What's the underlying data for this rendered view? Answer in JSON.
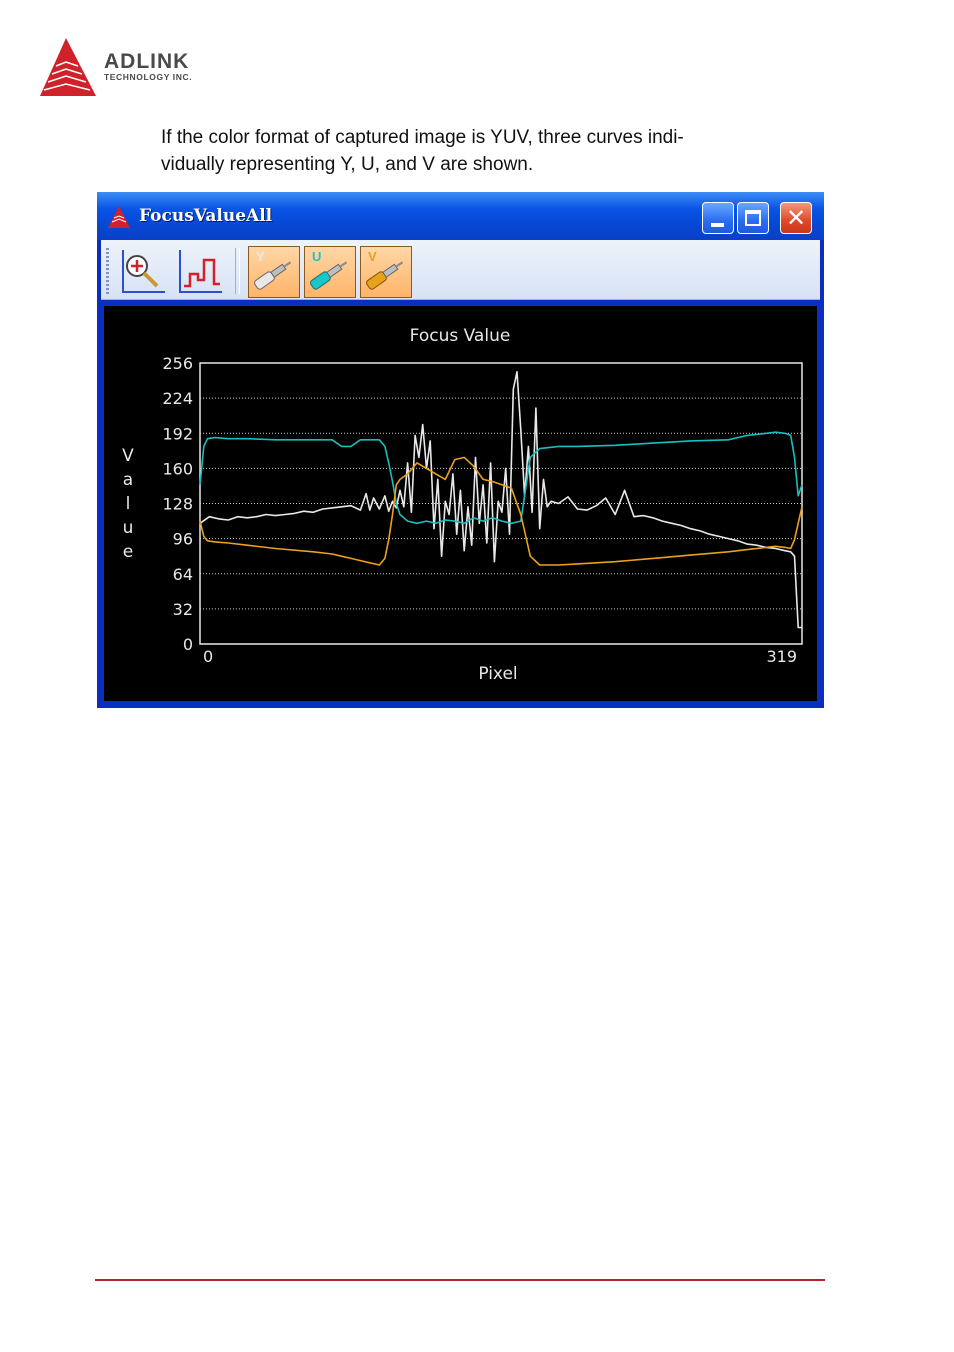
{
  "logo": {
    "name": "ADLINK",
    "subtitle": "TECHNOLOGY INC.",
    "brand_color": "#d0222a"
  },
  "intro": {
    "line1": "If the color format of captured image is YUV, three curves indi-",
    "line2": "vidually representing Y, U, and V are shown."
  },
  "window": {
    "title": "FocusValueAll",
    "controls": {
      "minimize": "minimize",
      "maximize": "maximize",
      "close": "close"
    }
  },
  "toolbar": {
    "buttons": [
      {
        "icon": "zoom-chart-icon",
        "label": ""
      },
      {
        "icon": "step-chart-icon",
        "label": ""
      },
      {
        "icon": "y-channel-cable-icon",
        "label": "Y",
        "color": "#d8d8d8",
        "active": true
      },
      {
        "icon": "u-channel-cable-icon",
        "label": "U",
        "color": "#18c8c8",
        "active": true
      },
      {
        "icon": "v-channel-cable-icon",
        "label": "V",
        "color": "#e8a21a",
        "active": true
      }
    ]
  },
  "chart_data": {
    "type": "line",
    "title": "Focus Value",
    "xlabel": "Pixel",
    "ylabel": "Value",
    "xlim": [
      0,
      319
    ],
    "ylim": [
      0,
      256
    ],
    "x_ticks": [
      "0",
      "319"
    ],
    "y_ticks": [
      "0",
      "32",
      "64",
      "96",
      "128",
      "160",
      "192",
      "224",
      "256"
    ],
    "grid": "horizontal-dotted",
    "background": "#000000",
    "series": [
      {
        "name": "Y",
        "color": "#e8e8e8",
        "x": [
          0,
          5,
          10,
          15,
          20,
          25,
          30,
          35,
          40,
          45,
          50,
          55,
          60,
          65,
          70,
          75,
          80,
          85,
          88,
          90,
          92,
          95,
          98,
          100,
          102,
          104,
          106,
          108,
          110,
          112,
          114,
          116,
          118,
          120,
          122,
          124,
          126,
          128,
          130,
          132,
          134,
          136,
          138,
          140,
          142,
          144,
          146,
          148,
          150,
          152,
          154,
          156,
          158,
          160,
          162,
          164,
          166,
          168,
          170,
          172,
          174,
          176,
          178,
          180,
          182,
          184,
          186,
          190,
          195,
          200,
          205,
          210,
          215,
          220,
          225,
          230,
          235,
          240,
          245,
          250,
          255,
          260,
          265,
          270,
          275,
          280,
          285,
          290,
          295,
          300,
          305,
          310,
          313,
          315,
          317,
          319
        ],
        "y": [
          110,
          116,
          114,
          113,
          116,
          115,
          116,
          118,
          117,
          118,
          119,
          121,
          120,
          123,
          124,
          125,
          126,
          122,
          137,
          122,
          133,
          123,
          135,
          121,
          130,
          124,
          140,
          125,
          165,
          120,
          190,
          170,
          200,
          160,
          185,
          105,
          150,
          80,
          130,
          118,
          155,
          100,
          140,
          85,
          125,
          90,
          170,
          110,
          145,
          92,
          165,
          75,
          130,
          120,
          160,
          100,
          232,
          248,
          195,
          135,
          180,
          120,
          215,
          105,
          150,
          125,
          130,
          128,
          134,
          123,
          122,
          126,
          133,
          118,
          140,
          116,
          117,
          115,
          112,
          110,
          108,
          105,
          103,
          100,
          98,
          96,
          94,
          91,
          90,
          88,
          87,
          85,
          84,
          80,
          15,
          15
        ]
      },
      {
        "name": "U",
        "color": "#19bfbf",
        "x": [
          0,
          2,
          4,
          8,
          15,
          25,
          40,
          60,
          70,
          75,
          80,
          85,
          90,
          95,
          98,
          100,
          102,
          104,
          106,
          110,
          115,
          120,
          125,
          130,
          135,
          140,
          145,
          150,
          155,
          160,
          165,
          170,
          175,
          180,
          190,
          200,
          220,
          240,
          260,
          280,
          290,
          300,
          305,
          310,
          313,
          315,
          317,
          319
        ],
        "y": [
          145,
          180,
          187,
          188,
          187,
          187,
          186,
          186,
          186,
          180,
          180,
          186,
          186,
          186,
          180,
          165,
          148,
          128,
          118,
          112,
          110,
          112,
          110,
          113,
          112,
          110,
          115,
          112,
          115,
          112,
          110,
          112,
          170,
          178,
          180,
          180,
          181,
          183,
          185,
          186,
          190,
          192,
          193,
          192,
          190,
          170,
          135,
          145
        ]
      },
      {
        "name": "V",
        "color": "#e8a21a",
        "x": [
          0,
          2,
          4,
          8,
          15,
          25,
          40,
          60,
          70,
          75,
          80,
          85,
          90,
          95,
          98,
          100,
          102,
          104,
          106,
          110,
          115,
          120,
          125,
          130,
          135,
          140,
          145,
          150,
          155,
          160,
          165,
          170,
          175,
          180,
          190,
          200,
          220,
          240,
          260,
          280,
          290,
          300,
          305,
          310,
          313,
          315,
          317,
          319
        ],
        "y": [
          112,
          98,
          94,
          93,
          92,
          90,
          87,
          84,
          82,
          80,
          78,
          76,
          74,
          72,
          78,
          95,
          118,
          145,
          150,
          155,
          165,
          160,
          155,
          150,
          168,
          170,
          162,
          150,
          148,
          145,
          142,
          118,
          80,
          72,
          72,
          73,
          75,
          78,
          81,
          84,
          86,
          88,
          89,
          88,
          87,
          95,
          110,
          125
        ]
      }
    ]
  }
}
